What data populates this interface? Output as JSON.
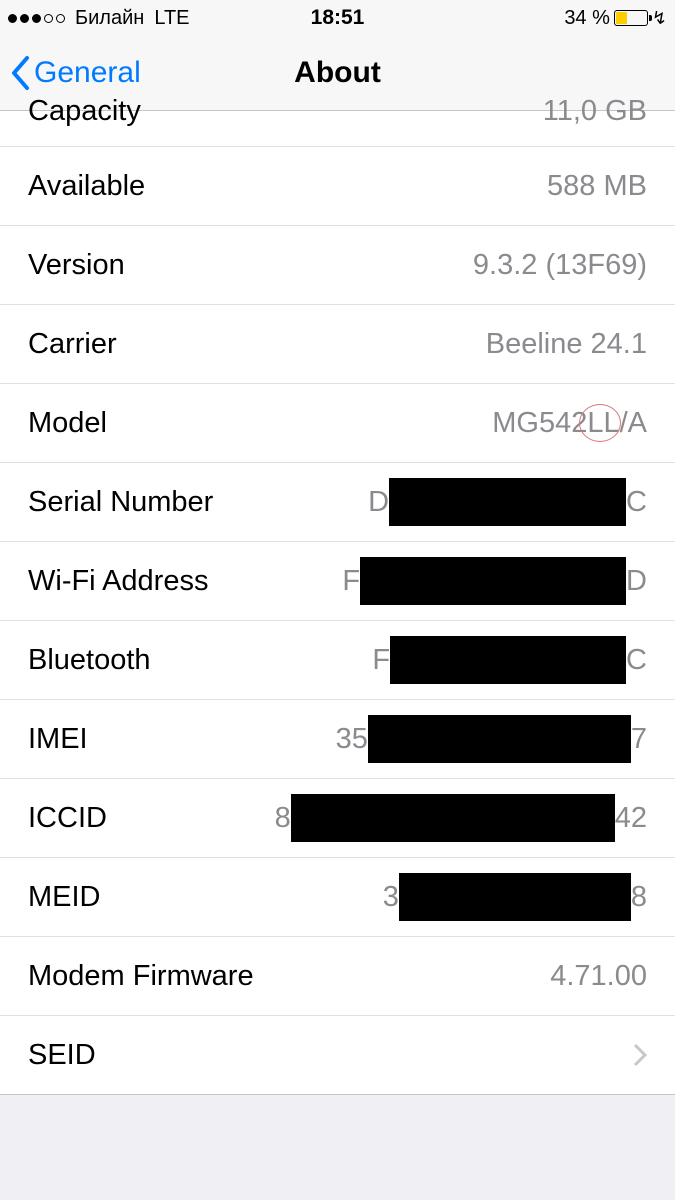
{
  "statusBar": {
    "carrier": "Билайн",
    "network": "LTE",
    "time": "18:51",
    "batteryPercent": "34 %"
  },
  "navBar": {
    "backLabel": "General",
    "title": "About"
  },
  "rows": {
    "capacity": {
      "label": "Capacity",
      "value": "11,0 GB"
    },
    "available": {
      "label": "Available",
      "value": "588 MB"
    },
    "version": {
      "label": "Version",
      "value": "9.3.2 (13F69)"
    },
    "carrier": {
      "label": "Carrier",
      "value": "Beeline 24.1"
    },
    "model": {
      "label": "Model",
      "value": "MG542LL/A"
    },
    "serial": {
      "label": "Serial Number",
      "prefix": "D",
      "suffix": "C"
    },
    "wifi": {
      "label": "Wi-Fi Address",
      "prefix": "F",
      "suffix": "D"
    },
    "bluetooth": {
      "label": "Bluetooth",
      "prefix": "F",
      "suffix": "C"
    },
    "imei": {
      "label": "IMEI",
      "prefix": "35",
      "suffix": "7"
    },
    "iccid": {
      "label": "ICCID",
      "prefix": "8",
      "suffix": "42"
    },
    "meid": {
      "label": "MEID",
      "prefix": "3",
      "suffix": "8"
    },
    "modem": {
      "label": "Modem Firmware",
      "value": "4.71.00"
    },
    "seid": {
      "label": "SEID"
    }
  }
}
